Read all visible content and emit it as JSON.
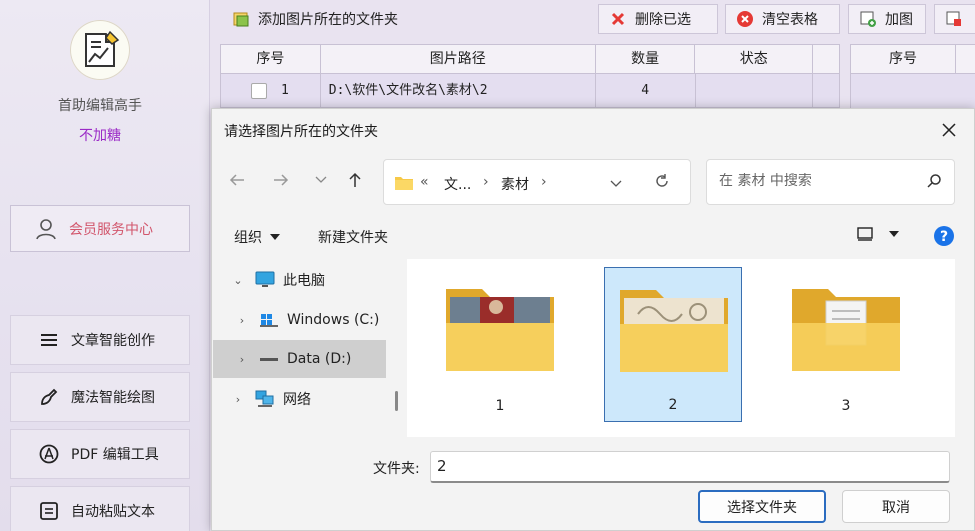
{
  "sidebar": {
    "app_name": "首助编辑高手",
    "subtitle": "不加糖",
    "member_label": "会员服务中心",
    "nav": [
      {
        "label": "文章智能创作",
        "icon": "menu-lines-icon"
      },
      {
        "label": "魔法智能绘图",
        "icon": "magic-brush-icon"
      },
      {
        "label": "PDF 编辑工具",
        "icon": "pdf-circle-icon"
      },
      {
        "label": "自动粘贴文本",
        "icon": "paste-board-icon"
      }
    ]
  },
  "toolbar": {
    "add_folder": "添加图片所在的文件夹",
    "delete_selected": "删除已选",
    "clear_table": "清空表格",
    "add_image": "加图"
  },
  "table": {
    "columns": [
      "序号",
      "图片路径",
      "数量",
      "状态"
    ],
    "rows": [
      {
        "index": "1",
        "path": "D:\\软件\\文件改名\\素材\\2",
        "count": "4",
        "status": ""
      }
    ]
  },
  "table2": {
    "columns": [
      "序号"
    ]
  },
  "dialog": {
    "title": "请选择图片所在的文件夹",
    "address": {
      "overflow": "«",
      "crumb1": "文...",
      "crumb2": "素材"
    },
    "search_placeholder": "在 素材 中搜索",
    "organize_label": "组织",
    "new_folder_label": "新建文件夹",
    "tree": [
      {
        "label": "此电脑",
        "icon": "computer-icon",
        "expanded": true
      },
      {
        "label": "Windows (C:)",
        "icon": "windows-drive-icon"
      },
      {
        "label": "Data (D:)",
        "icon": "drive-icon",
        "selected": true
      },
      {
        "label": "网络",
        "icon": "network-icon"
      }
    ],
    "files": [
      {
        "name": "1"
      },
      {
        "name": "2",
        "selected": true
      },
      {
        "name": "3"
      }
    ],
    "folder_label": "文件夹:",
    "folder_value": "2",
    "select_button": "选择文件夹",
    "cancel_button": "取消"
  },
  "colors": {
    "accent": "#2b6cc0",
    "sidebar_accent": "#9b2bc7",
    "member_text": "#d2566c",
    "selection": "#cde8fb"
  }
}
